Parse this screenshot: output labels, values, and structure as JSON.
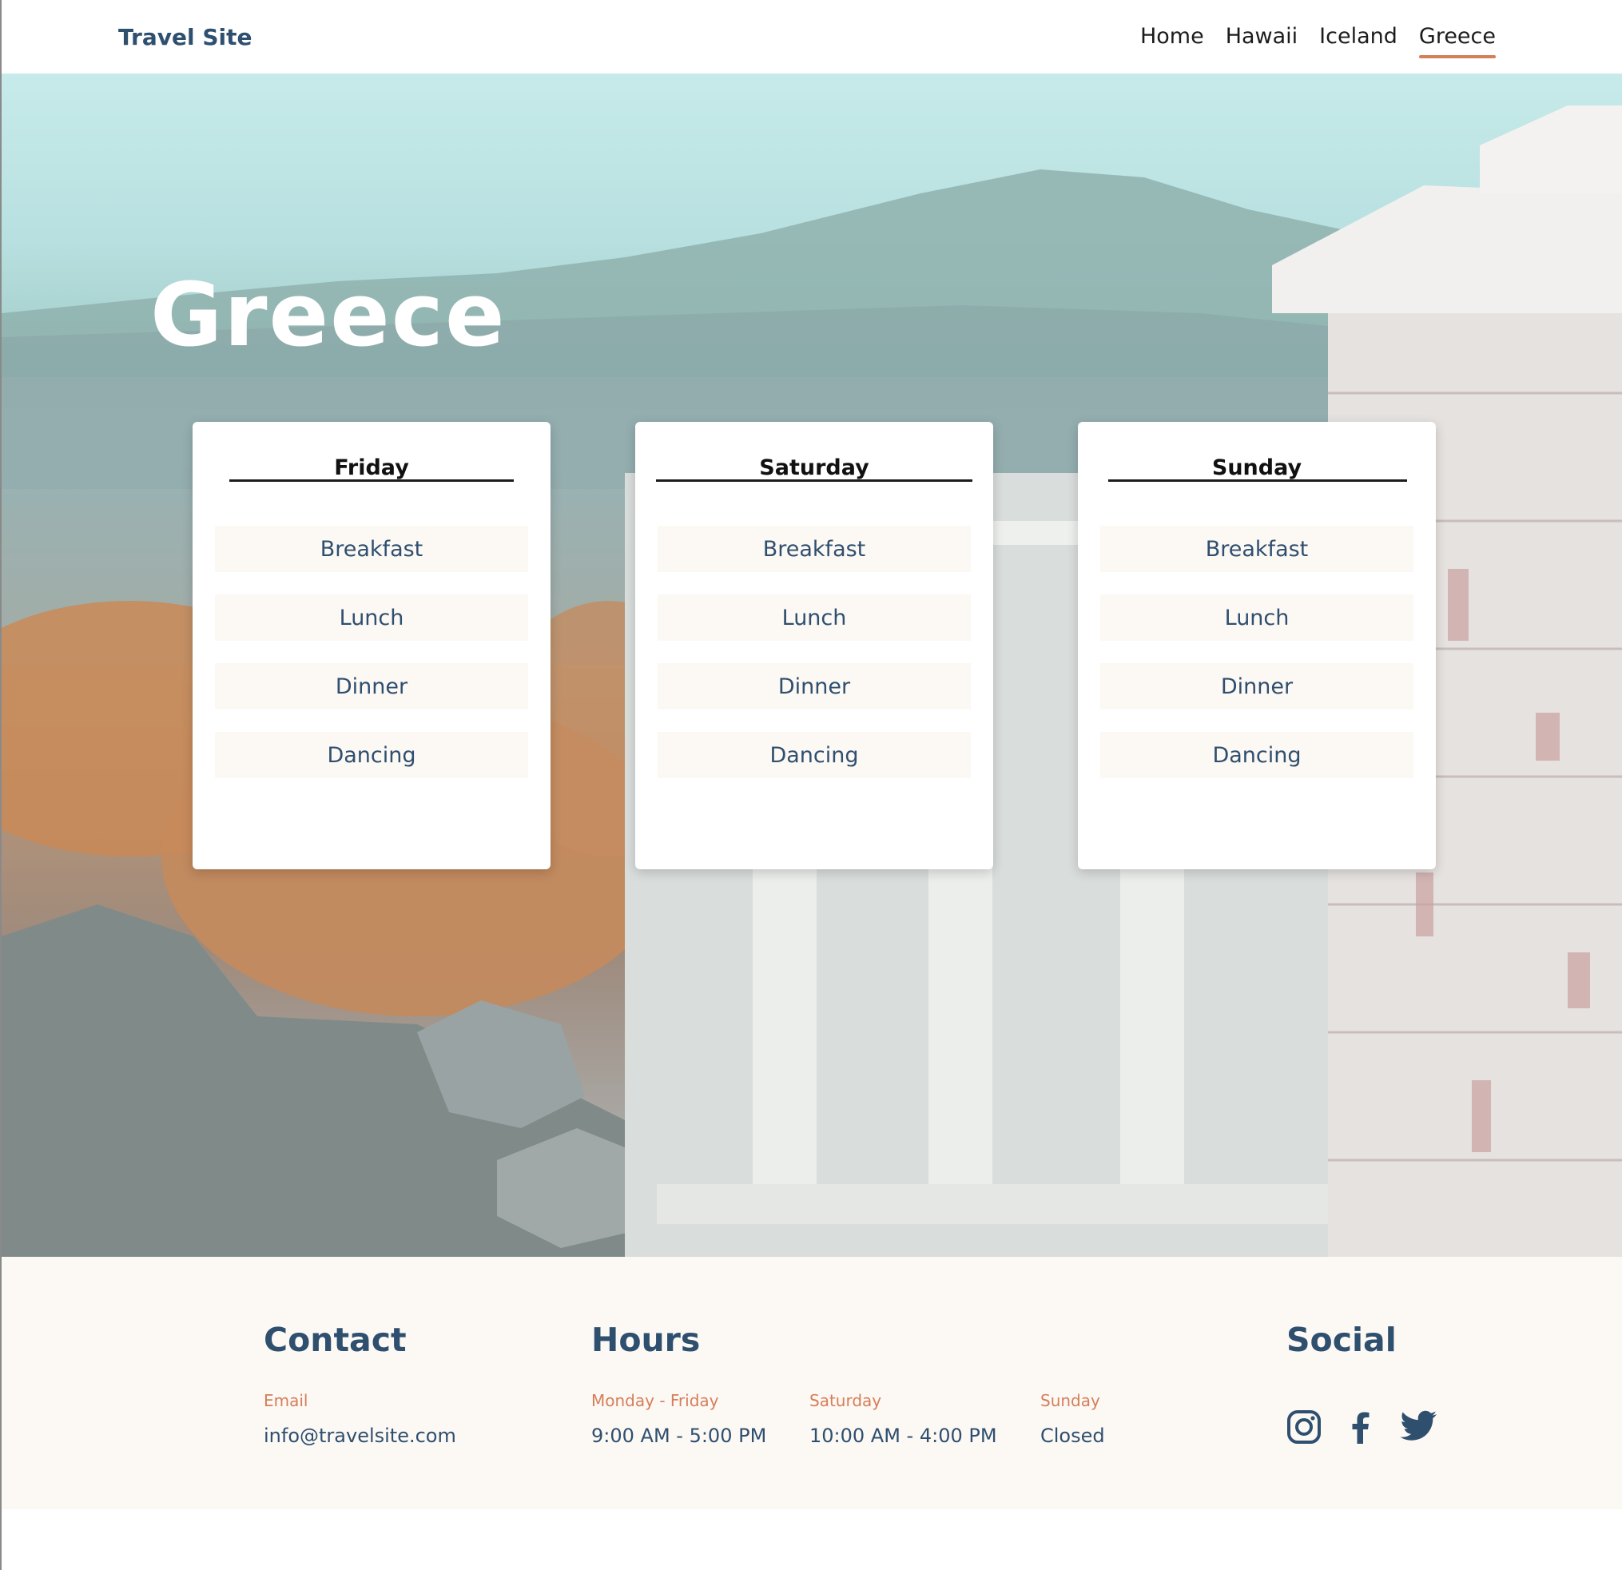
{
  "header": {
    "brand": "Travel Site",
    "nav": [
      "Home",
      "Hawaii",
      "Iceland",
      "Greece"
    ],
    "active": "Greece"
  },
  "hero": {
    "title": "Greece"
  },
  "schedule": [
    {
      "day": "Friday",
      "items": [
        "Breakfast",
        "Lunch",
        "Dinner",
        "Dancing"
      ]
    },
    {
      "day": "Saturday",
      "items": [
        "Breakfast",
        "Lunch",
        "Dinner",
        "Dancing"
      ]
    },
    {
      "day": "Sunday",
      "items": [
        "Breakfast",
        "Lunch",
        "Dinner",
        "Dancing"
      ]
    }
  ],
  "footer": {
    "contact": {
      "heading": "Contact",
      "email_label": "Email",
      "email": "info@travelsite.com"
    },
    "hours": {
      "heading": "Hours",
      "entries": [
        {
          "label": "Monday - Friday",
          "value": "9:00 AM - 5:00 PM"
        },
        {
          "label": "Saturday",
          "value": "10:00 AM - 4:00 PM"
        },
        {
          "label": "Sunday",
          "value": "Closed"
        }
      ]
    },
    "social": {
      "heading": "Social",
      "icons": [
        "instagram-icon",
        "facebook-icon",
        "twitter-icon"
      ]
    }
  },
  "colors": {
    "accent": "#d67e59",
    "primary": "#2f4f6f",
    "footer_bg": "#fcf8f4"
  }
}
